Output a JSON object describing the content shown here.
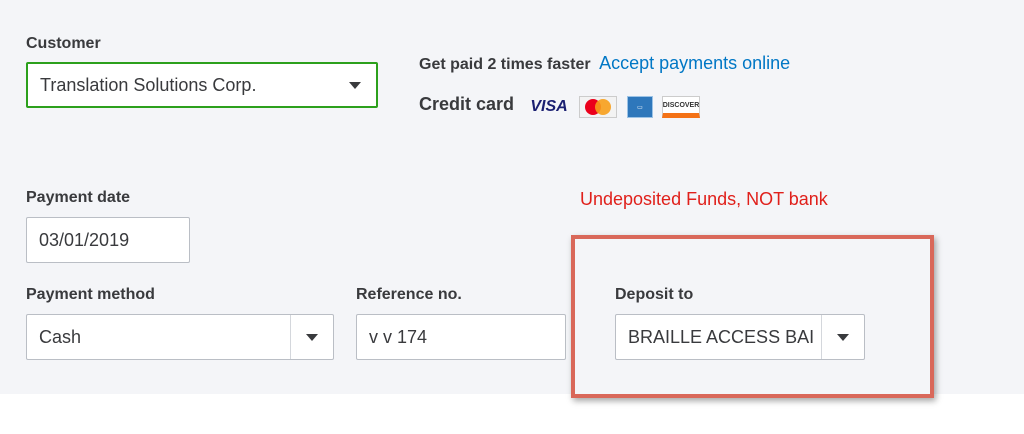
{
  "customer": {
    "label": "Customer",
    "value": "Translation Solutions Corp."
  },
  "promo": {
    "text": "Get paid 2 times faster",
    "link": "Accept payments online"
  },
  "credit_card": {
    "label": "Credit card",
    "cards": {
      "visa": "VISA",
      "mastercard": "MasterCard",
      "amex": "AMERICAN EXPRESS",
      "discover": "DISCOVER"
    }
  },
  "payment_date": {
    "label": "Payment date",
    "value": "03/01/2019"
  },
  "payment_method": {
    "label": "Payment method",
    "value": "Cash"
  },
  "reference": {
    "label": "Reference no.",
    "value": "v v 174"
  },
  "deposit_to": {
    "label": "Deposit to",
    "value": "BRAILLE ACCESS BAI"
  },
  "annotation": {
    "text": "Undeposited Funds, NOT bank",
    "color": "#e0201b",
    "box_color": "#d9685a"
  },
  "colors": {
    "accent": "#2ca01c",
    "link": "#0077c5"
  }
}
